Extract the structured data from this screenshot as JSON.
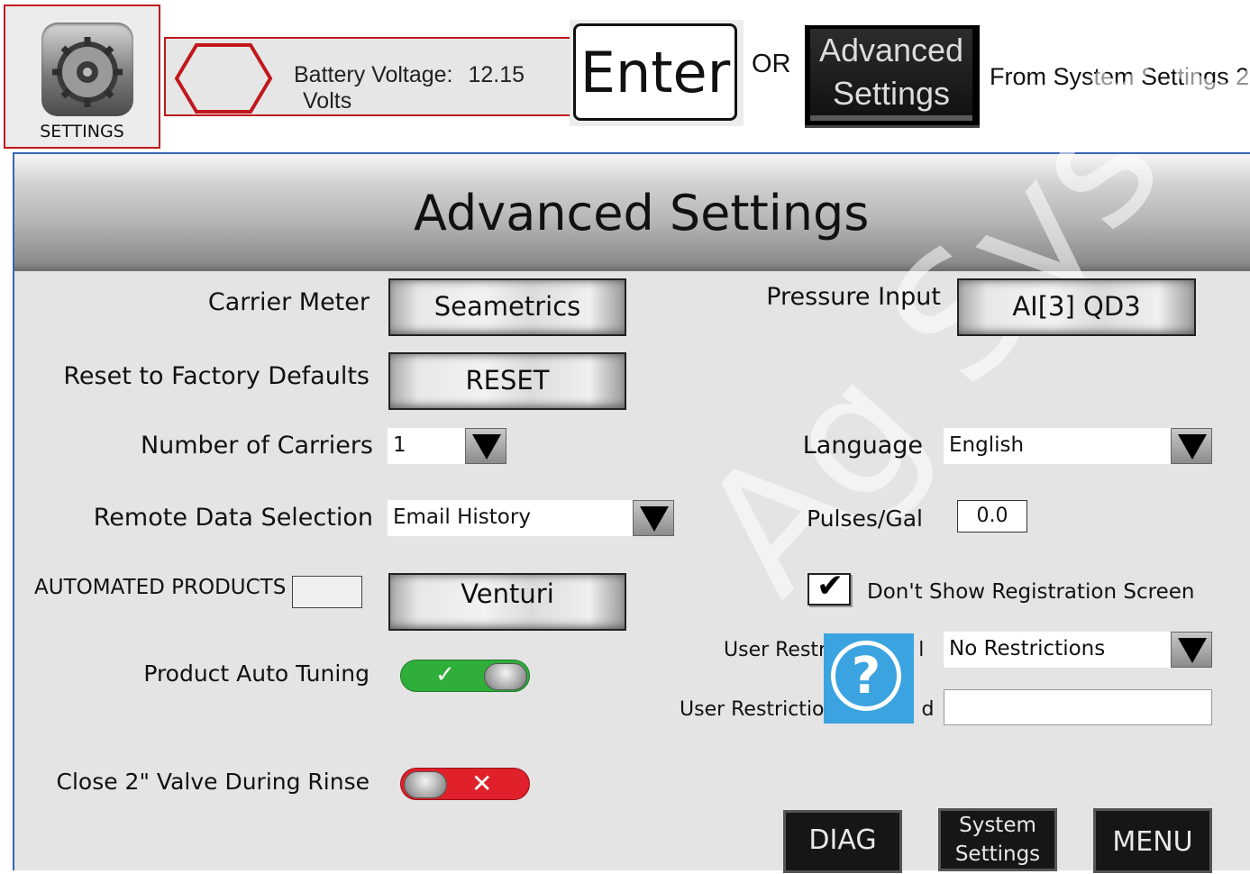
{
  "top_strip": {
    "settings_caption": "SETTINGS",
    "battery_label": "Battery Voltage:",
    "battery_value": "12.15",
    "battery_unit": "Volts",
    "enter_key": "Enter",
    "or_text": "OR",
    "advanced_key_line1": "Advanced",
    "advanced_key_line2": "Settings",
    "from_text": "From System Settings 2"
  },
  "panel": {
    "title": "Advanced Settings",
    "carrier_meter": {
      "label": "Carrier Meter",
      "value": "Seametrics"
    },
    "reset": {
      "label": "Reset to Factory Defaults",
      "button": "RESET"
    },
    "number_of_carriers": {
      "label": "Number of Carriers",
      "value": "1"
    },
    "remote_data": {
      "label": "Remote Data Selection",
      "value": "Email History"
    },
    "automated_products": {
      "label": "AUTOMATED PRODUCTS",
      "input_value": "",
      "button": "Venturi"
    },
    "product_auto_tuning": {
      "label": "Product Auto Tuning",
      "state": "on",
      "on_glyph": "✓"
    },
    "close_valve": {
      "label": "Close 2\" Valve During Rinse",
      "state": "off",
      "off_glyph": "✕"
    },
    "pressure_input": {
      "label": "Pressure Input",
      "value": "AI[3]  QD3"
    },
    "language": {
      "label": "Language",
      "value": "English"
    },
    "pulses_gal": {
      "label": "Pulses/Gal",
      "value": "0.0"
    },
    "registration": {
      "label": "Don't Show Registration Screen",
      "checked": true,
      "check_glyph": "✔"
    },
    "user_restriction_level": {
      "label_left": "User Restri",
      "label_right": "l",
      "value": "No Restrictions"
    },
    "user_restriction_password": {
      "label_left": "User Restriction",
      "label_right": "d",
      "value": ""
    },
    "help_glyph": "?",
    "buttons": {
      "diag": "DIAG",
      "system_line1": "System",
      "system_line2": "Settings",
      "menu": "MENU"
    }
  },
  "colors": {
    "highlight_border": "#c0181d",
    "toggle_on": "#2fae3a",
    "toggle_off": "#e0202a",
    "help_blue": "#3aa3e0"
  }
}
